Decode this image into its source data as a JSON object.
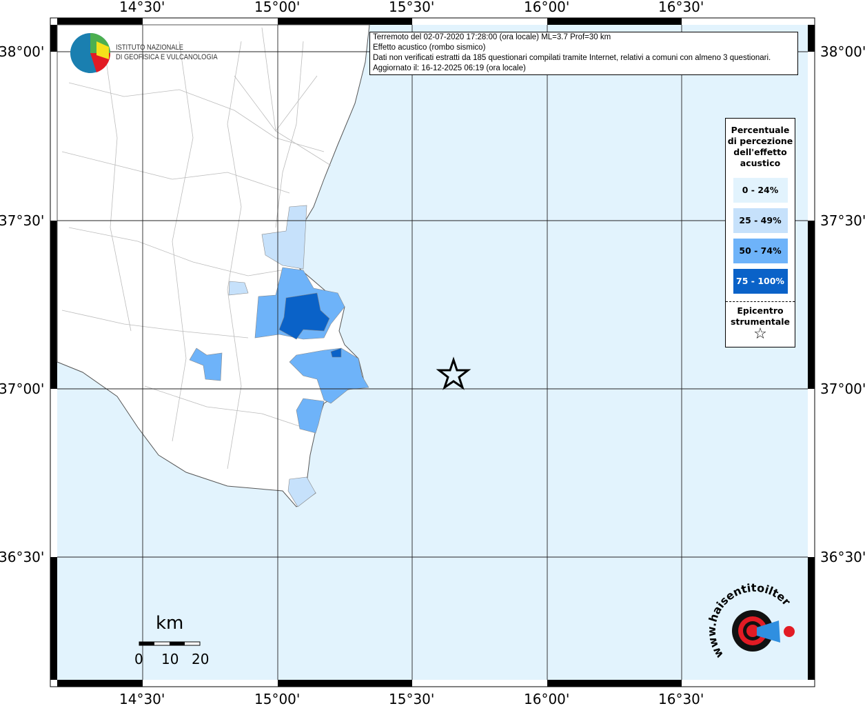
{
  "header": {
    "lines": [
      "Terremoto del 02-07-2020 17:28:00 (ora locale) ML=3.7 Prof=30 km",
      "Effetto acustico (rombo sismico)",
      "Dati non verificati estratti da 185 questionari compilati tramite Internet, relativi a comuni con almeno 3 questionari.",
      "Aggiornato il: 16-12-2025 06:19 (ora locale)"
    ]
  },
  "axes": {
    "lon": [
      "14°30'",
      "15°00'",
      "15°30'",
      "16°00'",
      "16°30'"
    ],
    "lat": [
      "38°00'",
      "37°30'",
      "37°00'",
      "36°30'"
    ]
  },
  "legend": {
    "title": [
      "Percentuale",
      "di percezione",
      "dell'effetto",
      "acustico"
    ],
    "classes": [
      {
        "label": "0 - 24%",
        "color": "#e2f3fd"
      },
      {
        "label": "25 - 49%",
        "color": "#c6e1fb"
      },
      {
        "label": "50 - 74%",
        "color": "#6eb3f9"
      },
      {
        "label": "75 - 100%",
        "color": "#0a62c8"
      }
    ],
    "epicenter": [
      "Epicentro",
      "strumentale"
    ]
  },
  "logo": {
    "ingv": [
      "ISTITUTO NAZIONALE",
      "DI GEOFISICA E VULCANOLOGIA"
    ],
    "hsit": "www.haisentitoilterremoto.it"
  },
  "scale": {
    "unit": "km",
    "ticks": [
      "0",
      "10",
      "20"
    ]
  },
  "colors": {
    "sea": "#e2f3fd",
    "land": "#ffffff"
  }
}
